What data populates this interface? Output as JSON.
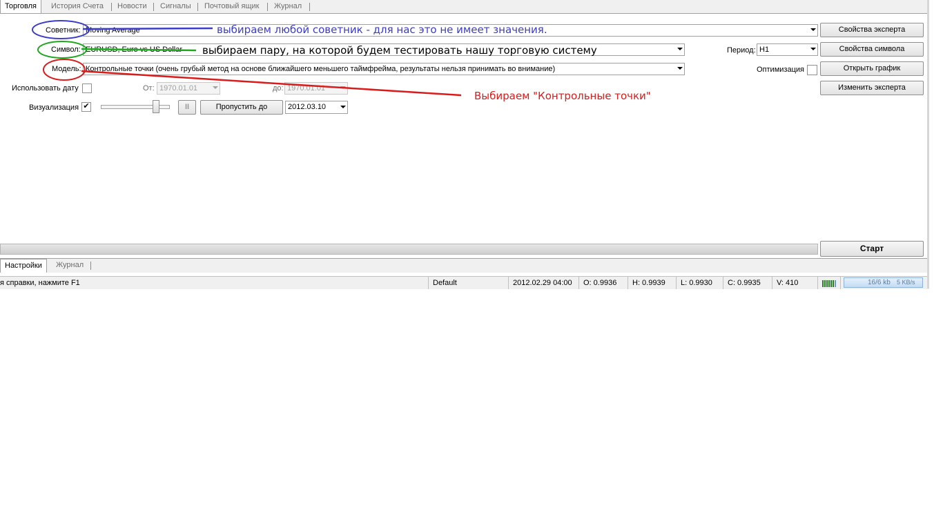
{
  "tabs": [
    "Торговля",
    "История Счета",
    "Новости",
    "Сигналы",
    "Почтовый ящик",
    "Журнал"
  ],
  "form": {
    "expert_label": "Советник:",
    "expert_value": "Moving Average",
    "symbol_label": "Символ:",
    "symbol_value": "EURUSD, Euro vs US Dollar",
    "model_label": "Модель:",
    "model_value": "Контрольные точки (очень грубый метод на основе ближайшего меньшего таймфрейма, результаты нельзя принимать во внимание)",
    "period_label": "Период:",
    "period_value": "H1",
    "optimization_label": "Оптимизация",
    "use_date_label": "Использовать дату",
    "from_label": "От:",
    "from_value": "1970.01.01",
    "to_label": "до:",
    "to_value": "1970.01.01",
    "visual_label": "Визуализация",
    "visual_checked": "✔",
    "pause_label": "II",
    "skip_to_label": "Пропустить до",
    "skip_to_value": "2012.03.10"
  },
  "buttons": {
    "expert_props": "Свойства эксперта",
    "symbol_props": "Свойства символа",
    "open_chart": "Открыть график",
    "modify_expert": "Изменить эксперта",
    "start": "Старт"
  },
  "annotations": {
    "expert": "выбираем любой советник - для нас это не имеет значения.",
    "symbol": "выбираем пару, на которой будем тестировать нашу торговую систему",
    "model": "Выбираем \"Контрольные точки\"",
    "colors": {
      "blue": "#3c3cc8",
      "green": "#1fa81f",
      "red": "#d81c1c"
    }
  },
  "bottom_tabs": [
    "Настройки",
    "Журнал"
  ],
  "status": {
    "help": "я справки, нажмите F1",
    "profile": "Default",
    "datetime": "2012.02.29 04:00",
    "open": "O: 0.9936",
    "high": "H: 0.9939",
    "low": "L: 0.9930",
    "close": "C: 0.9935",
    "volume": "V: 410",
    "traffic": "16/6 kb",
    "speed": "5 KB/s"
  }
}
